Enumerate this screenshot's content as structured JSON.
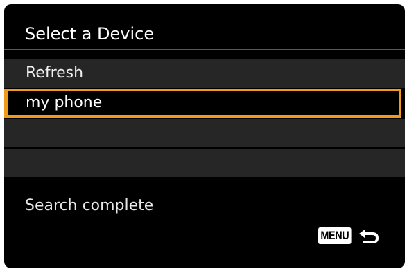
{
  "title": "Select a Device",
  "list": {
    "items": [
      {
        "label": "Refresh",
        "selected": false
      },
      {
        "label": "my phone",
        "selected": true
      },
      {
        "label": "",
        "selected": false
      },
      {
        "label": "",
        "selected": false
      }
    ]
  },
  "status": "Search complete",
  "footer": {
    "menu_label": "MENU",
    "back_icon": "return-arrow-icon"
  },
  "colors": {
    "background": "#000000",
    "row_background": "#262626",
    "selection_accent": "#f09a1a",
    "text": "#ffffff"
  }
}
